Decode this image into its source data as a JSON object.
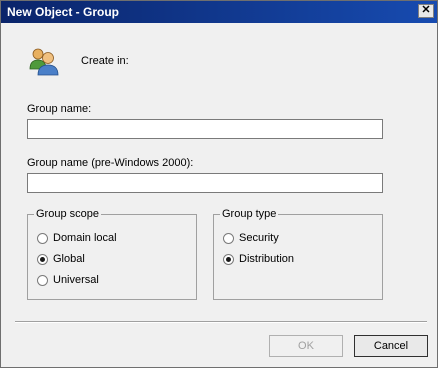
{
  "window": {
    "title": "New Object - Group",
    "close_label": "✕"
  },
  "create_in": {
    "label": "Create in:"
  },
  "group_name": {
    "label": "Group name:",
    "value": ""
  },
  "group_name_pre2000": {
    "label": "Group name (pre-Windows 2000):",
    "value": ""
  },
  "group_scope": {
    "title": "Group scope",
    "options": [
      {
        "label": "Domain local",
        "selected": false
      },
      {
        "label": "Global",
        "selected": true
      },
      {
        "label": "Universal",
        "selected": false
      }
    ]
  },
  "group_type": {
    "title": "Group type",
    "options": [
      {
        "label": "Security",
        "selected": false
      },
      {
        "label": "Distribution",
        "selected": true
      }
    ]
  },
  "buttons": {
    "ok": "OK",
    "cancel": "Cancel"
  },
  "colors": {
    "titlebar": "#0a246a",
    "dialog_bg": "#f0f0f0"
  },
  "icons": {
    "group": "group-users-icon"
  }
}
